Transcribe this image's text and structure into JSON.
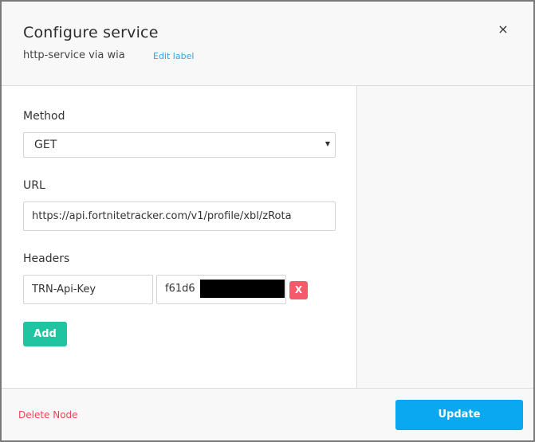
{
  "header": {
    "title": "Configure service",
    "subtitle": "http-service via wia",
    "edit_label": "Edit label",
    "close_glyph": "×"
  },
  "form": {
    "method_label": "Method",
    "method_value": "GET",
    "url_label": "URL",
    "url_value": "https://api.fortnitetracker.com/v1/profile/xbl/zRota",
    "headers_label": "Headers",
    "header_key": "TRN-Api-Key",
    "header_value_visible": "f61d6",
    "remove_label": "X",
    "add_label": "Add"
  },
  "footer": {
    "delete_label": "Delete Node",
    "update_label": "Update"
  },
  "colors": {
    "accent_blue": "#0aa8f0",
    "add_green": "#20c4a0",
    "danger_red": "#f45a6a",
    "link_blue": "#3aa0e0"
  },
  "icons": {
    "close": "close-icon",
    "dropdown": "chevron-down-icon"
  }
}
